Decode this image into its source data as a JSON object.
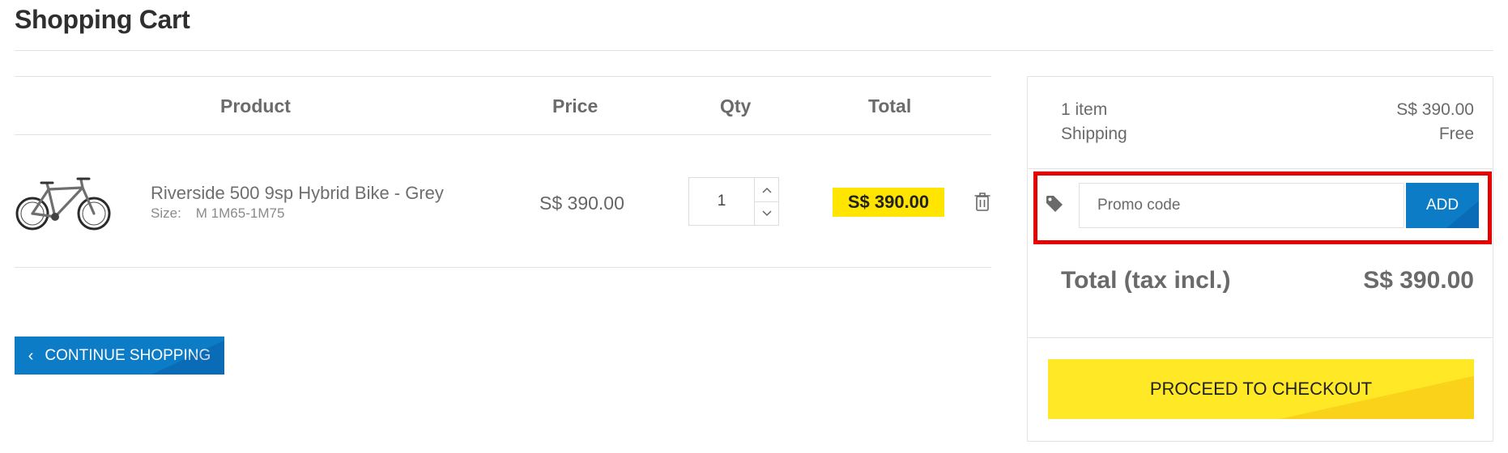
{
  "page": {
    "title": "Shopping Cart"
  },
  "cart": {
    "columns": {
      "product": "Product",
      "price": "Price",
      "qty": "Qty",
      "total": "Total"
    },
    "items": [
      {
        "name": "Riverside 500 9sp Hybrid Bike - Grey",
        "size_label": "Size:",
        "size_value": "M 1M65-1M75",
        "price": "S$ 390.00",
        "qty": "1",
        "total": "S$ 390.00",
        "image_icon": "hybrid-bike-image"
      }
    ],
    "continue_label": "CONTINUE SHOPPING"
  },
  "summary": {
    "items_count": "1 item",
    "items_price": "S$ 390.00",
    "shipping_label": "Shipping",
    "shipping_value": "Free",
    "promo": {
      "placeholder": "Promo code",
      "value": "",
      "add_label": "ADD",
      "icon": "tag-icon"
    },
    "total_label": "Total (tax incl.)",
    "total_value": "S$ 390.00",
    "checkout_label": "PROCEED TO CHECKOUT"
  },
  "colors": {
    "accent_blue": "#0d7cc7",
    "highlight_yellow": "#ffe500",
    "checkout_yellow": "#ffe927",
    "promo_frame_red": "#e60000"
  }
}
